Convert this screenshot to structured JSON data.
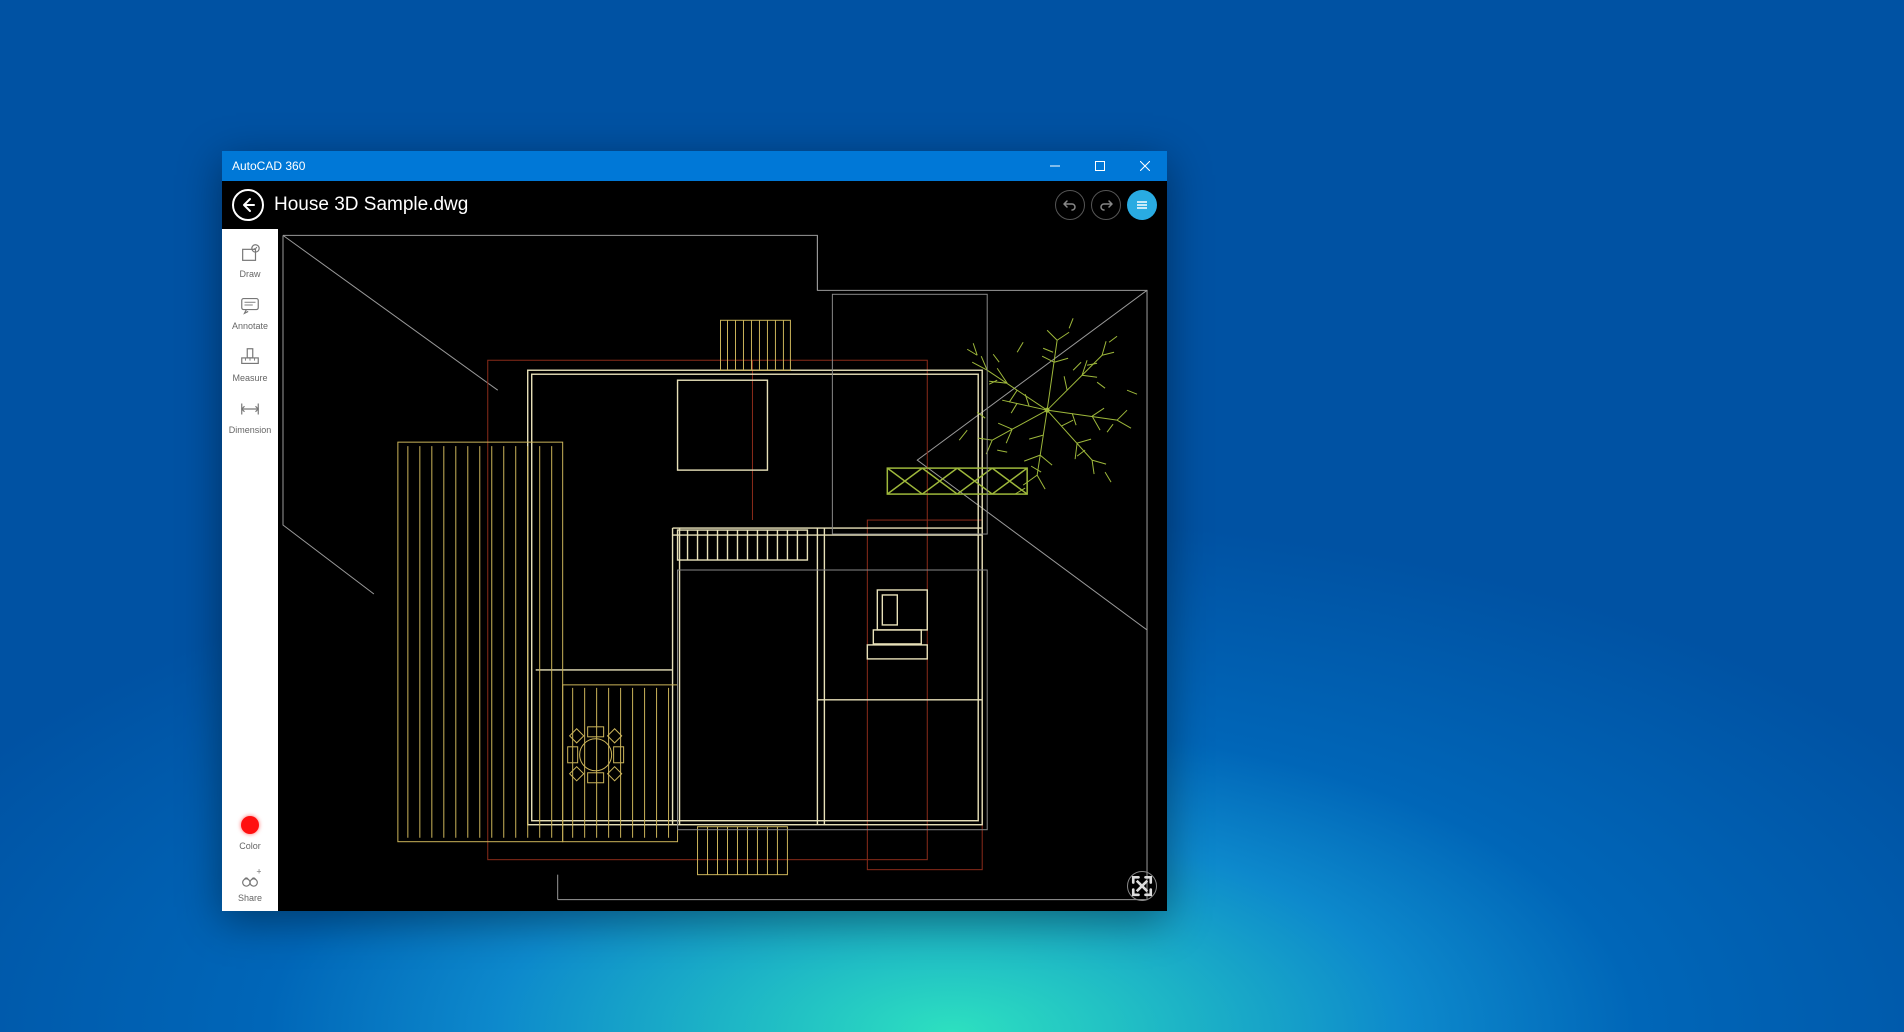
{
  "window": {
    "app_title": "AutoCAD 360"
  },
  "header": {
    "filename": "House 3D Sample.dwg"
  },
  "tools": [
    {
      "id": "draw",
      "label": "Draw"
    },
    {
      "id": "annotate",
      "label": "Annotate"
    },
    {
      "id": "measure",
      "label": "Measure"
    },
    {
      "id": "dimension",
      "label": "Dimension"
    }
  ],
  "bottom_tools": [
    {
      "id": "color",
      "label": "Color",
      "swatch": "#ff1010"
    },
    {
      "id": "share",
      "label": "Share"
    }
  ],
  "colors": {
    "accent": "#0078d7",
    "menu": "#29abe2",
    "cad_yellow": "#cbb45a",
    "cad_cream": "#e8e1b9",
    "cad_red": "#8b2b1a",
    "cad_gray": "#aaaaaa",
    "cad_green": "#9eb83b"
  }
}
